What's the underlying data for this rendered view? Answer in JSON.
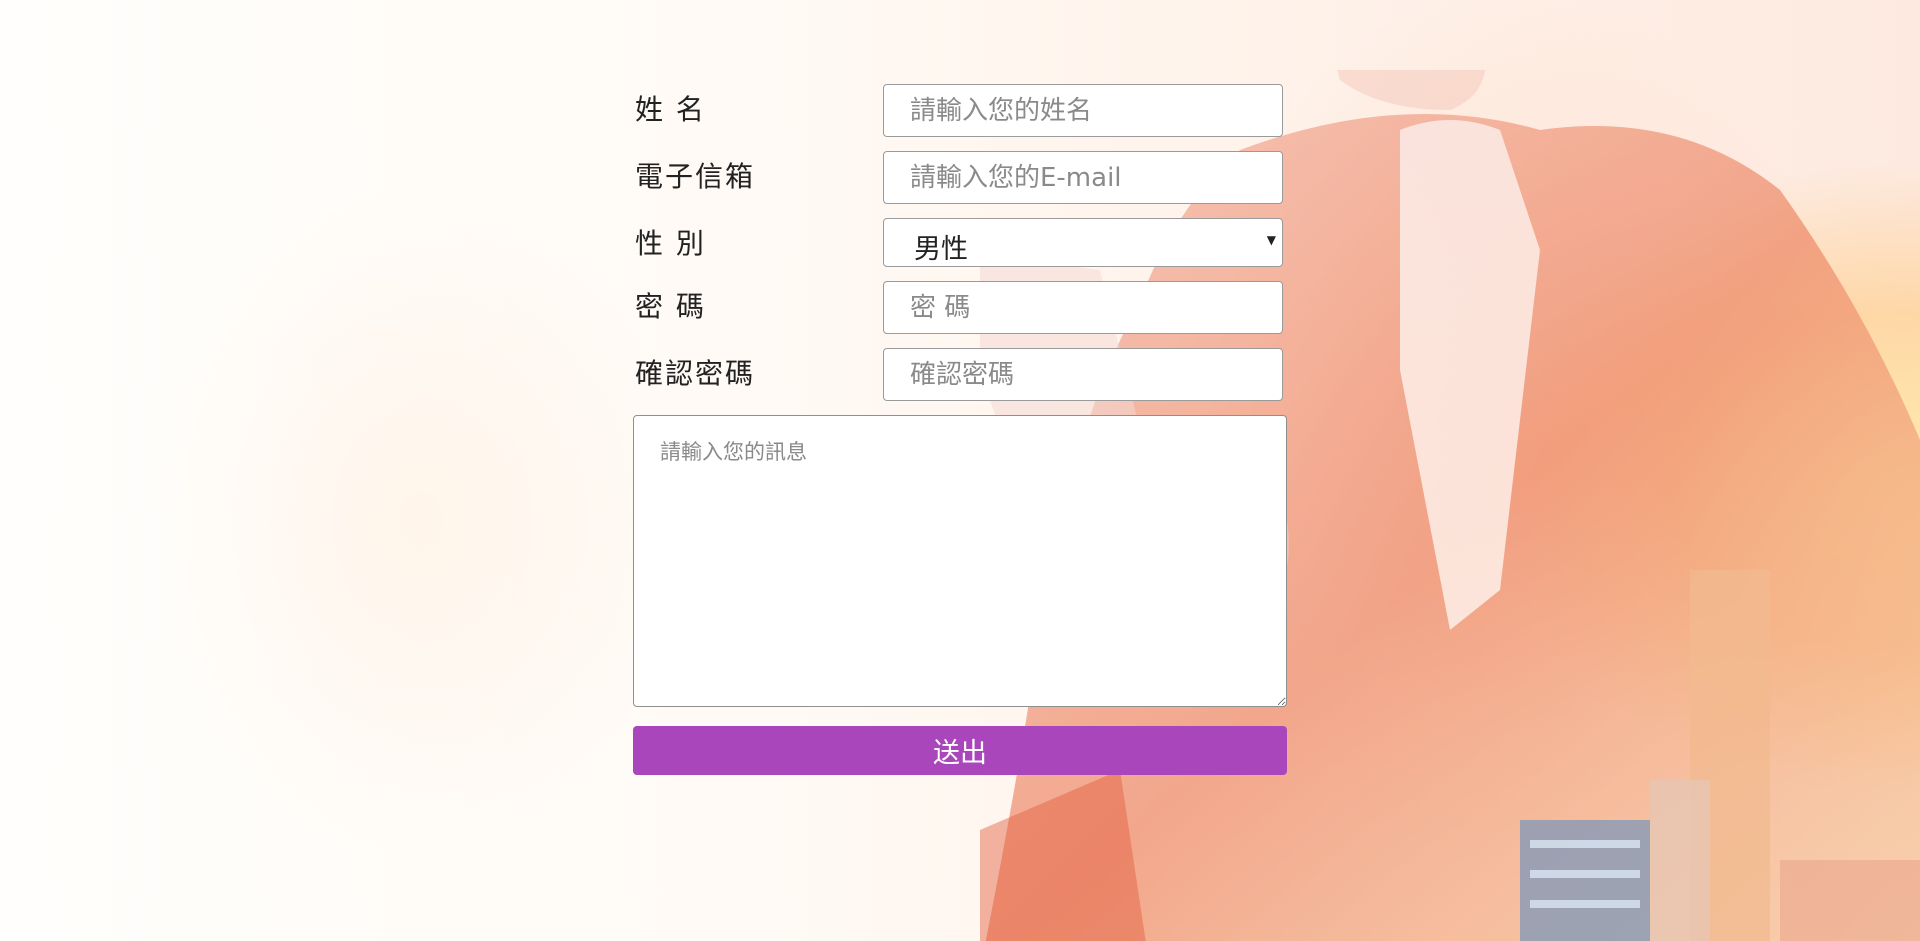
{
  "form": {
    "name": {
      "label": "姓 名",
      "placeholder": "請輸入您的姓名"
    },
    "email": {
      "label": "電子信箱",
      "placeholder": "請輸入您的E-mail"
    },
    "gender": {
      "label": "性 別",
      "selected": "男性"
    },
    "password": {
      "label": "密 碼",
      "placeholder": "密 碼"
    },
    "confirm_password": {
      "label": "確認密碼",
      "placeholder": "確認密碼"
    },
    "message": {
      "placeholder": "請輸入您的訊息"
    },
    "submit_label": "送出"
  },
  "colors": {
    "submit_button": "#a946bc",
    "field_border": "#9a9a9a"
  }
}
